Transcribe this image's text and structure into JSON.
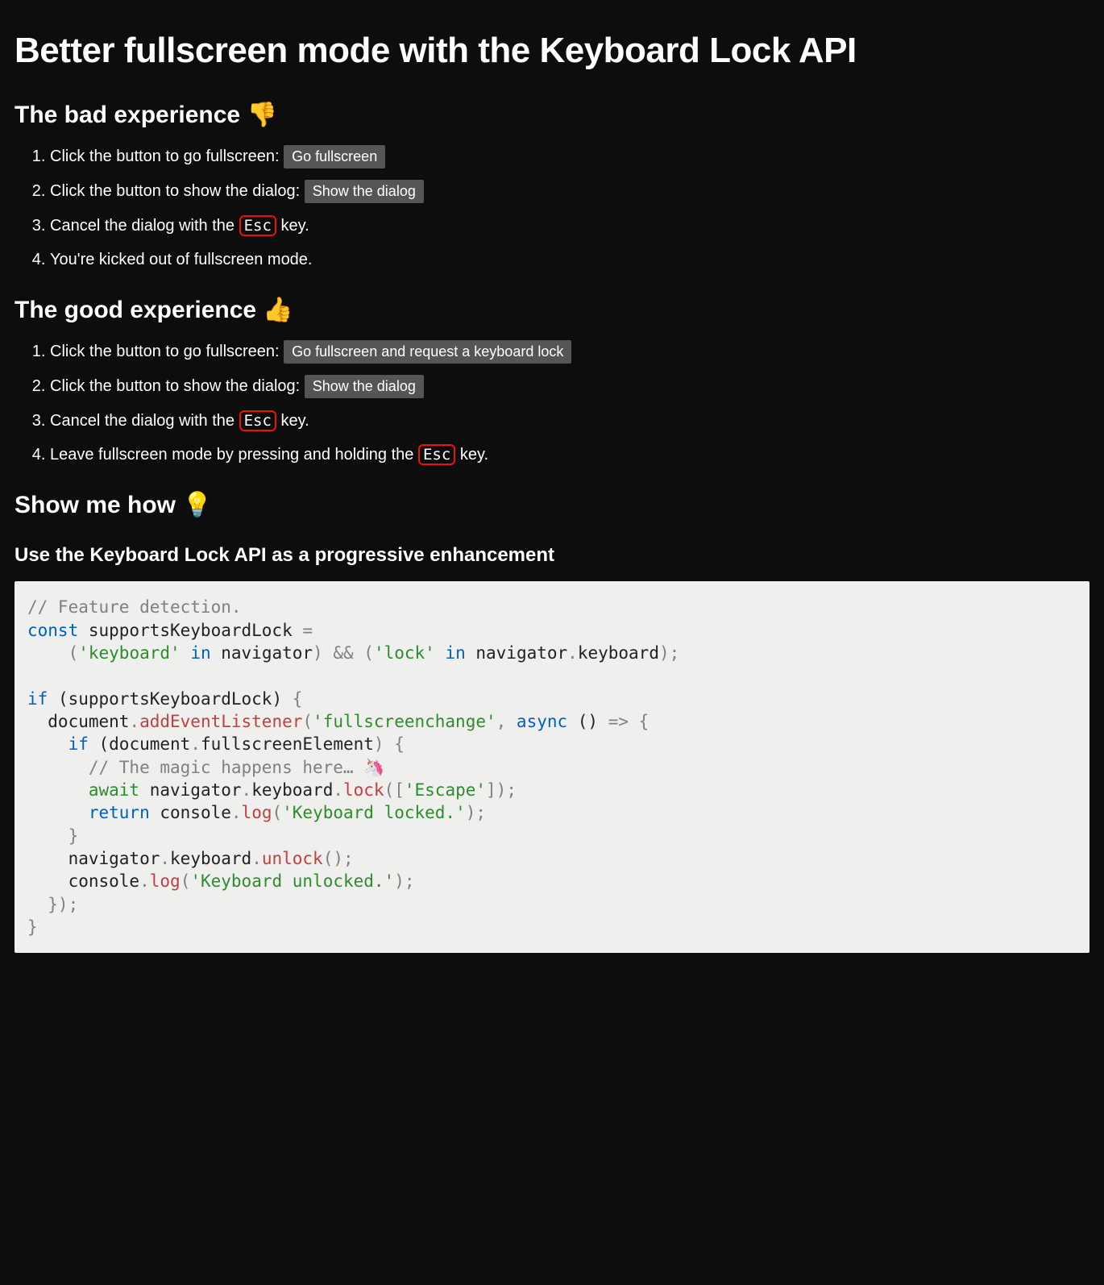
{
  "title": "Better fullscreen mode with the Keyboard Lock API",
  "bad": {
    "heading": "The bad experience 👎",
    "step1_text": "Click the button to go fullscreen: ",
    "step1_button": "Go fullscreen",
    "step2_text": "Click the button to show the dialog: ",
    "step2_button": "Show the dialog",
    "step3_before": "Cancel the dialog with the ",
    "step3_kbd": "Esc",
    "step3_after": " key.",
    "step4": "You're kicked out of fullscreen mode."
  },
  "good": {
    "heading": "The good experience 👍",
    "step1_text": "Click the button to go fullscreen: ",
    "step1_button": "Go fullscreen and request a keyboard lock",
    "step2_text": "Click the button to show the dialog: ",
    "step2_button": "Show the dialog",
    "step3_before": "Cancel the dialog with the ",
    "step3_kbd": "Esc",
    "step3_after": " key.",
    "step4_before": "Leave fullscreen mode by pressing and holding the ",
    "step4_kbd": "Esc",
    "step4_after": " key."
  },
  "how": {
    "heading": "Show me how 💡",
    "subheading": "Use the Keyboard Lock API as a progressive enhancement"
  },
  "code": {
    "c1": "// Feature detection.",
    "kw_const": "const",
    "id_supports": " supportsKeyboardLock ",
    "eq": "=",
    "indent1": "    ",
    "p_open1": "(",
    "str_keyboard": "'keyboard'",
    "kw_in1": " in ",
    "id_nav1": "navigator",
    "p_close1": ")",
    "and": " && ",
    "p_open2": "(",
    "str_lock": "'lock'",
    "kw_in2": " in ",
    "id_nav2": "navigator",
    "dot1": ".",
    "id_kb1": "keyboard",
    "p_close2": ");",
    "kw_if": "if",
    "if_cond": " (supportsKeyboardLock) ",
    "brace_open1": "{",
    "l_doc": "  document",
    "dot2": ".",
    "fn_add": "addEventListener",
    "p_open3": "(",
    "str_fsc": "'fullscreenchange'",
    "comma1": ", ",
    "kw_async": "async",
    "arrow_head": " () ",
    "arrow": "=>",
    "brace_open2": " {",
    "l_if2_pre": "    ",
    "kw_if2": "if",
    "if2_cond_open": " (document",
    "dot3": ".",
    "id_fse": "fullscreenElement",
    "if2_cond_close": ") {",
    "l_comment2_pre": "      ",
    "c2": "// The magic happens here… 🦄",
    "l_await_pre": "      ",
    "kw_await": "await",
    "sp1": " ",
    "id_nav3": "navigator",
    "dot4": ".",
    "id_kb2": "keyboard",
    "dot5": ".",
    "fn_lock": "lock",
    "p_open4": "([",
    "str_escape": "'Escape'",
    "p_close4": "]);",
    "l_ret_pre": "      ",
    "kw_return": "return",
    "sp2": " ",
    "id_console1": "console",
    "dot6": ".",
    "fn_log1": "log",
    "p_open5": "(",
    "str_locked": "'Keyboard locked.'",
    "p_close5": ");",
    "l_close_if2": "    }",
    "l_nav4_pre": "    ",
    "id_nav4": "navigator",
    "dot7": ".",
    "id_kb3": "keyboard",
    "dot8": ".",
    "fn_unlock": "unlock",
    "p_call1": "();",
    "l_console2_pre": "    ",
    "id_console2": "console",
    "dot9": ".",
    "fn_log2": "log",
    "p_open6": "(",
    "str_unlocked": "'Keyboard unlocked.'",
    "p_close6": ");",
    "l_close_cb": "  });",
    "l_close_if1": "}"
  }
}
